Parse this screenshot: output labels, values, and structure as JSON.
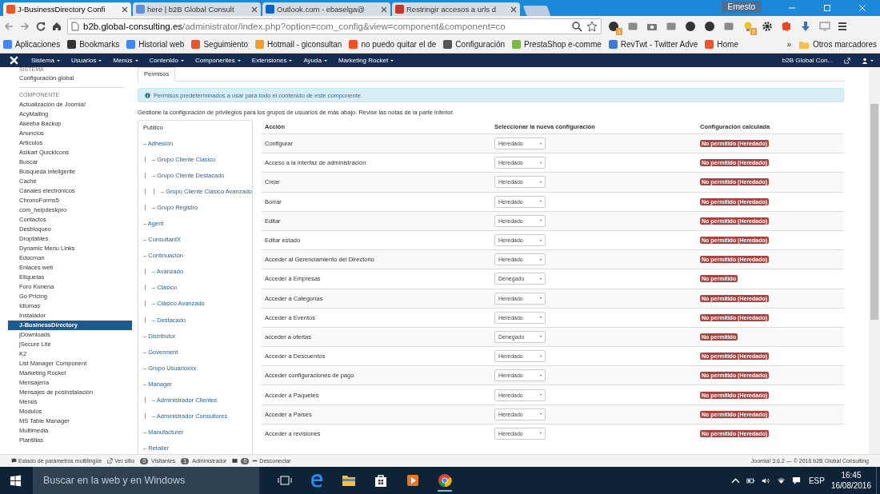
{
  "browser": {
    "tabs": [
      {
        "title": "J-BusinessDirectory Confi",
        "kind": "joomla",
        "selected": true
      },
      {
        "title": "here | b2B Global Consult",
        "kind": "globe",
        "selected": false
      },
      {
        "title": "Outlook.com - ebaselga@",
        "kind": "outlook",
        "selected": false
      },
      {
        "title": "Restringir accesos a urls d",
        "kind": "wrike",
        "selected": false
      }
    ],
    "profile": "Ernesto",
    "url": {
      "host": "b2b.global-consulting.es",
      "path": "/administrator/index.php?option=com_config&view=component&component=co"
    },
    "extensions": [
      {
        "kind": "circle",
        "badge": "1"
      },
      {
        "kind": "square"
      },
      {
        "kind": "camera"
      },
      {
        "kind": "square"
      },
      {
        "kind": "circle"
      },
      {
        "kind": "circle"
      },
      {
        "kind": "square"
      },
      {
        "kind": "bulb",
        "badge": "3"
      },
      {
        "kind": "gear"
      },
      {
        "kind": "office"
      },
      {
        "kind": "arrow"
      },
      {
        "kind": "monitor"
      }
    ],
    "bookmarks": [
      {
        "label": "Aplicaciones",
        "kind": "apps"
      },
      {
        "label": "Bookmarks",
        "kind": "star"
      },
      {
        "label": "Historial web",
        "kind": "google"
      },
      {
        "label": "Seguimiento",
        "kind": "joomla"
      },
      {
        "label": "Hotmail - giconsultan",
        "kind": "mail"
      },
      {
        "label": "no puedo quitar el de",
        "kind": "windows"
      },
      {
        "label": "Configuración",
        "kind": "gear"
      },
      {
        "label": "PrestaShop e-comme",
        "kind": "presta"
      },
      {
        "label": "RevTwt - Twitter Adve",
        "kind": "drop"
      },
      {
        "label": "Home",
        "kind": "joomla"
      }
    ],
    "more": "»",
    "other_bookmarks": "Otros marcadores"
  },
  "admin_menu": {
    "items": [
      "Sistema",
      "Usuarios",
      "Menús",
      "Contenido",
      "Componentes",
      "Extensiones",
      "Ayuda",
      "Marketing Rocket"
    ],
    "site": "b2B Global Con..."
  },
  "sidebar": {
    "system_heading": "SISTEMA",
    "global": "Configuración global",
    "component_heading": "COMPONENTE",
    "items": [
      {
        "label": "Actualización de Joomla!",
        "selected": false
      },
      {
        "label": "AcyMailing",
        "selected": false
      },
      {
        "label": "Akeeba Backup",
        "selected": false
      },
      {
        "label": "Anuncios",
        "selected": false
      },
      {
        "label": "Artículos",
        "selected": false
      },
      {
        "label": "Asikart QuickIcons",
        "selected": false
      },
      {
        "label": "Buscar",
        "selected": false
      },
      {
        "label": "Búsqueda inteligente",
        "selected": false
      },
      {
        "label": "Caché",
        "selected": false
      },
      {
        "label": "Canales electrónicos",
        "selected": false
      },
      {
        "label": "ChronoForms5",
        "selected": false
      },
      {
        "label": "com_helpdeskpro",
        "selected": false
      },
      {
        "label": "Contactos",
        "selected": false
      },
      {
        "label": "Desbloqueo",
        "selected": false
      },
      {
        "label": "Droptables",
        "selected": false
      },
      {
        "label": "Dynamic Menu Links",
        "selected": false
      },
      {
        "label": "Edocman",
        "selected": false
      },
      {
        "label": "Enlaces web",
        "selected": false
      },
      {
        "label": "Etiquetas",
        "selected": false
      },
      {
        "label": "Foro Kunena",
        "selected": false
      },
      {
        "label": "Go Pricing",
        "selected": false
      },
      {
        "label": "Idiomas",
        "selected": false
      },
      {
        "label": "Instalador",
        "selected": false
      },
      {
        "label": "J-BusinessDirectory",
        "selected": true
      },
      {
        "label": "jDownloads",
        "selected": false
      },
      {
        "label": "jSecure Lite",
        "selected": false
      },
      {
        "label": "K2",
        "selected": false
      },
      {
        "label": "List Manager Component",
        "selected": false
      },
      {
        "label": "Marketing Rocket",
        "selected": false
      },
      {
        "label": "Mensajería",
        "selected": false
      },
      {
        "label": "Mensajes de posinstalación",
        "selected": false
      },
      {
        "label": "Menús",
        "selected": false
      },
      {
        "label": "Módulos",
        "selected": false
      },
      {
        "label": "MS Table Manager",
        "selected": false
      },
      {
        "label": "Multimedia",
        "selected": false
      },
      {
        "label": "Plantillas",
        "selected": false
      }
    ]
  },
  "tabs": [
    {
      "label": "Permisos",
      "selected": true
    }
  ],
  "alert": "Permisos predeterminados a usar para todo el contenido de este componente.",
  "intro": "Gestione la configuración de privilegios para los grupos de usuarios de más abajo. Revise las notas de la parte inferior.",
  "groups": [
    {
      "label": "Publico",
      "selected": true,
      "children": [
        {
          "label": "– Adhesión",
          "selected": false,
          "children": [
            {
              "label": "– Grupo Cliente Clasico",
              "selected": false
            },
            {
              "label": "– Grupo Cliente Destacado",
              "selected": false,
              "children": [
                {
                  "label": "– Grupo Cliente Clásico Avanzado",
                  "selected": false
                }
              ]
            },
            {
              "label": "– Grupo Registro",
              "selected": false
            }
          ]
        },
        {
          "label": "– Agent",
          "selected": false
        },
        {
          "label": "– ConsultantX",
          "selected": false
        },
        {
          "label": "– Continuación",
          "selected": false,
          "children": [
            {
              "label": "– Avanzado",
              "selected": false
            },
            {
              "label": "– Clásico",
              "selected": false
            },
            {
              "label": "– Clásico Avanzado",
              "selected": false
            },
            {
              "label": "– Destacado",
              "selected": false
            }
          ]
        },
        {
          "label": "– Distributor",
          "selected": false
        },
        {
          "label": "– Goverment",
          "selected": false
        },
        {
          "label": "– Grupo Usuarioxxx",
          "selected": false
        },
        {
          "label": "– Manager",
          "selected": false,
          "children": [
            {
              "label": "– Administrador Clientes",
              "selected": false
            },
            {
              "label": "– Administrador Consultores",
              "selected": false
            }
          ]
        },
        {
          "label": "– Manufacturer",
          "selected": false
        },
        {
          "label": "– Retailer",
          "selected": false
        }
      ]
    }
  ],
  "table": {
    "columns": [
      "Acción",
      "Seleccionar la nueva configuración",
      "Configuración calculada"
    ],
    "rows": [
      {
        "action": "Configurar",
        "setting": "Heredado",
        "calculated": "No permitido (Heredado)"
      },
      {
        "action": "Acceso a la interfaz de administración",
        "setting": "Heredado",
        "calculated": "No permitido (Heredado)"
      },
      {
        "action": "Crear",
        "setting": "Heredado",
        "calculated": "No permitido (Heredado)"
      },
      {
        "action": "Borrar",
        "setting": "Heredado",
        "calculated": "No permitido (Heredado)"
      },
      {
        "action": "Editar",
        "setting": "Heredado",
        "calculated": "No permitido (Heredado)"
      },
      {
        "action": "Editar estado",
        "setting": "Heredado",
        "calculated": "No permitido (Heredado)"
      },
      {
        "action": "Acceder al Gerenciamiento del Directorio",
        "setting": "Heredado",
        "calculated": "No permitido (Heredado)"
      },
      {
        "action": "Acceder a Empresas",
        "setting": "Denegado",
        "calculated": "No permitido"
      },
      {
        "action": "Acceder a Categorías",
        "setting": "Heredado",
        "calculated": "No permitido (Heredado)"
      },
      {
        "action": "Acceder a Eventos",
        "setting": "Heredado",
        "calculated": "No permitido (Heredado)"
      },
      {
        "action": "acceder a ofertas",
        "setting": "Denegado",
        "calculated": "No permitido"
      },
      {
        "action": "Acceder a Descuentos",
        "setting": "Heredado",
        "calculated": "No permitido (Heredado)"
      },
      {
        "action": "Acceder configuraciones de pago",
        "setting": "Heredado",
        "calculated": "No permitido (Heredado)"
      },
      {
        "action": "Acceder a Paquetes",
        "setting": "Heredado",
        "calculated": "No permitido (Heredado)"
      },
      {
        "action": "Acceder a Países",
        "setting": "Heredado",
        "calculated": "No permitido (Heredado)"
      },
      {
        "action": "Acceder a revisiones",
        "setting": "Heredado",
        "calculated": "No permitido (Heredado)"
      }
    ]
  },
  "status_bar": {
    "multilingual": "Estado de parámetros multilingüe",
    "view_site": "Ver sitio",
    "visitors_count": "0",
    "visitors": "Visitantes",
    "admins_count": "1",
    "admins": "Administrador",
    "messages_count": "0",
    "logout": "Desconectar",
    "version": "Joomla! 3.6.2 — © 2016 b2B Global Consulting"
  },
  "taskbar": {
    "search": {
      "placeholder": "Buscar en la web y en Windows"
    },
    "language": "ESP",
    "time": "16:45",
    "date": "16/08/2016"
  }
}
